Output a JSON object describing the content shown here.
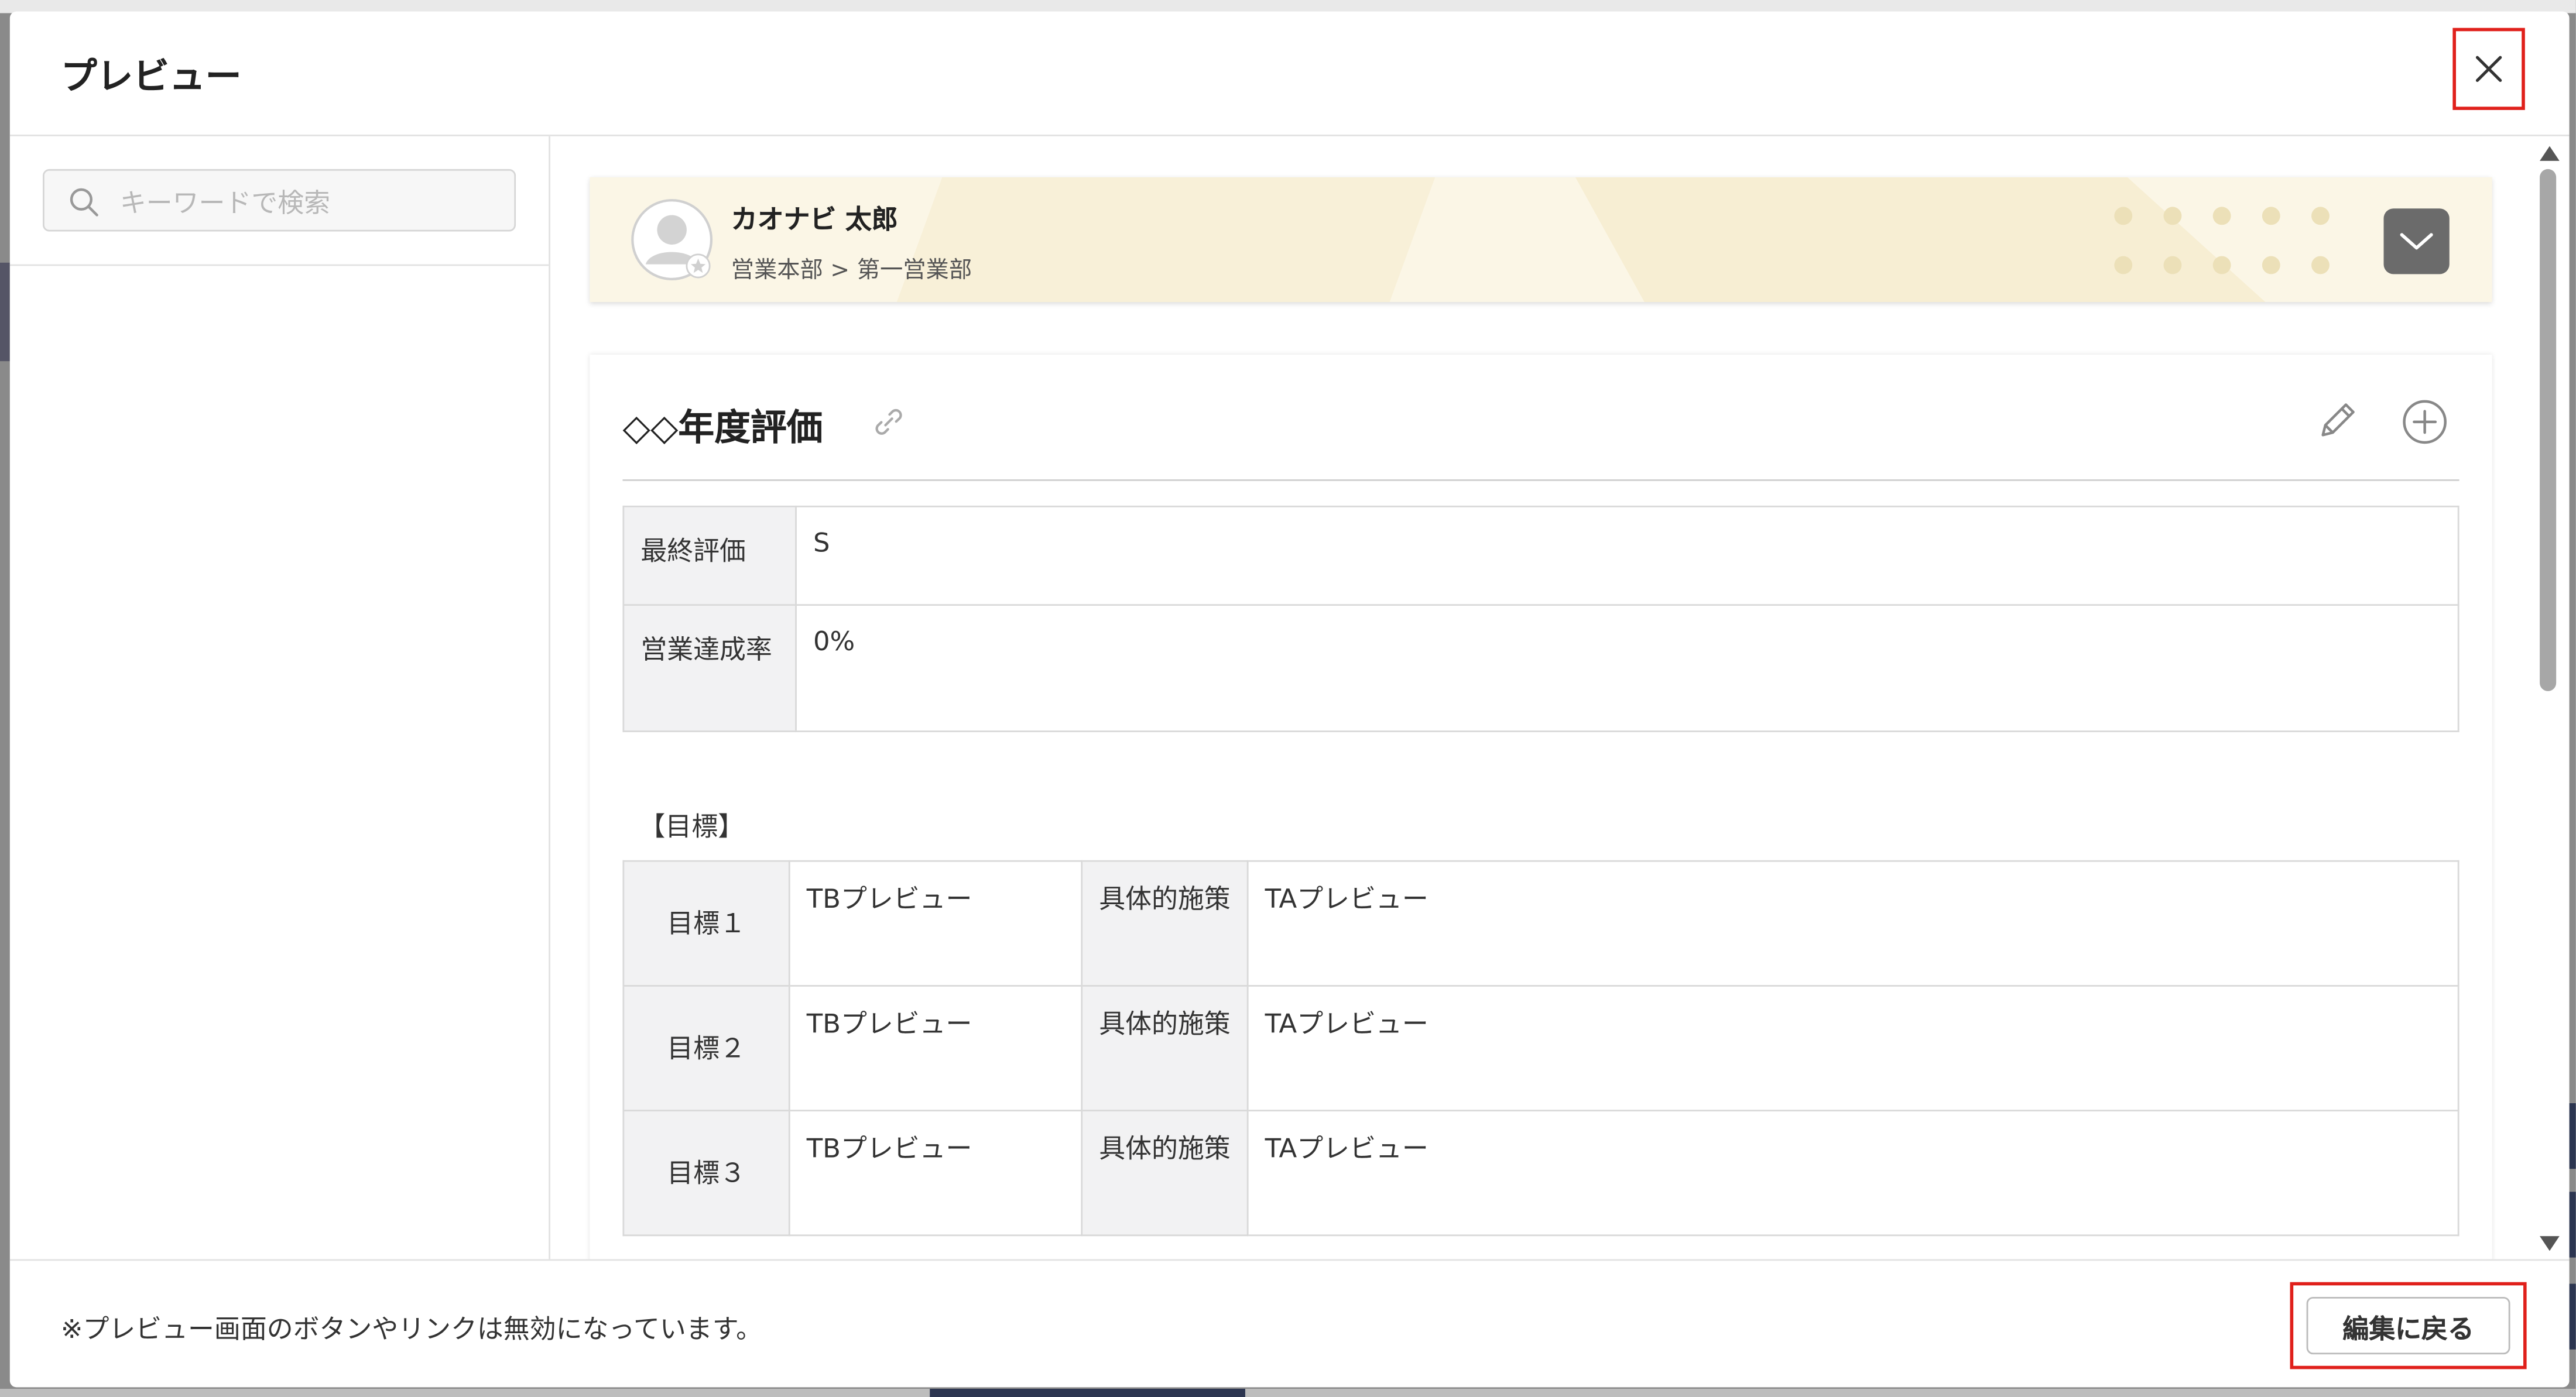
{
  "modal": {
    "title": "プレビュー",
    "close_icon": "close-icon"
  },
  "search": {
    "placeholder": "キーワードで検索",
    "value": "",
    "icon": "search-icon"
  },
  "profile": {
    "name": "カオナビ 太郎",
    "department": "営業本部 > 第一営業部",
    "avatar_icon": "avatar-placeholder-icon",
    "expand_icon": "chevron-down-icon"
  },
  "evaluation": {
    "title": "◇◇年度評価",
    "link_icon": "link-icon",
    "edit_icon": "pencil-icon",
    "add_icon": "plus-circle-icon",
    "fields": [
      {
        "label": "最終評価",
        "value": "S"
      },
      {
        "label": "営業達成率",
        "value": "0%"
      }
    ],
    "goals_heading": "【目標】",
    "goals": [
      {
        "label": "目標１",
        "value": "TBプレビュー",
        "measure_label": "具体的施策",
        "measure_value": "TAプレビュー"
      },
      {
        "label": "目標２",
        "value": "TBプレビュー",
        "measure_label": "具体的施策",
        "measure_value": "TAプレビュー"
      },
      {
        "label": "目標３",
        "value": "TBプレビュー",
        "measure_label": "具体的施策",
        "measure_value": "TAプレビュー"
      }
    ]
  },
  "footer": {
    "note": "※プレビュー画面のボタンやリンクは無効になっています。",
    "back_button": "編集に戻る"
  },
  "colors": {
    "highlight": "#e0201b",
    "profile_bg": "#fbf6e6",
    "label_bg": "#f2f2f3",
    "expand_button": "#6b6b6b"
  }
}
